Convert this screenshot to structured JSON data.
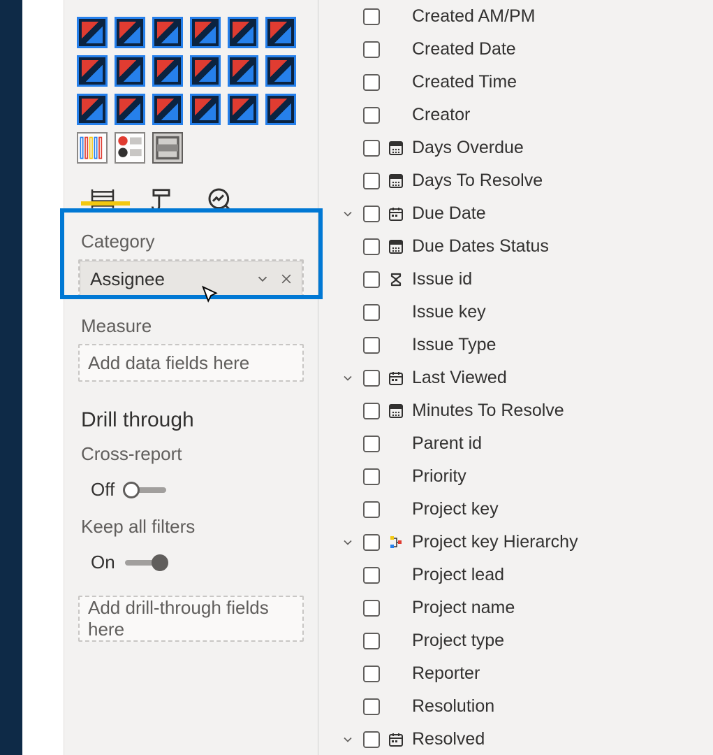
{
  "visualizations_panel": {
    "tabs": [
      "fields",
      "format",
      "analytics"
    ],
    "wells": {
      "category": {
        "label": "Category",
        "field": "Assignee"
      },
      "measure": {
        "label": "Measure",
        "placeholder": "Add data fields here"
      }
    },
    "drill_through": {
      "title": "Drill through",
      "cross_report": {
        "label": "Cross-report",
        "state_label": "Off",
        "on": false
      },
      "keep_filters": {
        "label": "Keep all filters",
        "state_label": "On",
        "on": true
      },
      "dropzone_placeholder": "Add drill-through fields here"
    }
  },
  "fields_panel": {
    "items": [
      {
        "name": "Created AM/PM",
        "type": null,
        "expandable": false
      },
      {
        "name": "Created Date",
        "type": null,
        "expandable": false
      },
      {
        "name": "Created Time",
        "type": null,
        "expandable": false
      },
      {
        "name": "Creator",
        "type": null,
        "expandable": false
      },
      {
        "name": "Days Overdue",
        "type": "calc",
        "expandable": false
      },
      {
        "name": "Days To Resolve",
        "type": "calc",
        "expandable": false
      },
      {
        "name": "Due Date",
        "type": "date",
        "expandable": true
      },
      {
        "name": "Due Dates Status",
        "type": "calc",
        "expandable": false
      },
      {
        "name": "Issue id",
        "type": "sigma",
        "expandable": false
      },
      {
        "name": "Issue key",
        "type": null,
        "expandable": false
      },
      {
        "name": "Issue Type",
        "type": null,
        "expandable": false
      },
      {
        "name": "Last Viewed",
        "type": "date",
        "expandable": true
      },
      {
        "name": "Minutes To Resolve",
        "type": "calc",
        "expandable": false
      },
      {
        "name": "Parent id",
        "type": null,
        "expandable": false
      },
      {
        "name": "Priority",
        "type": null,
        "expandable": false
      },
      {
        "name": "Project key",
        "type": null,
        "expandable": false
      },
      {
        "name": "Project key Hierarchy",
        "type": "hierarchy",
        "expandable": true
      },
      {
        "name": "Project lead",
        "type": null,
        "expandable": false
      },
      {
        "name": "Project name",
        "type": null,
        "expandable": false
      },
      {
        "name": "Project type",
        "type": null,
        "expandable": false
      },
      {
        "name": "Reporter",
        "type": null,
        "expandable": false
      },
      {
        "name": "Resolution",
        "type": null,
        "expandable": false
      },
      {
        "name": "Resolved",
        "type": "date",
        "expandable": true
      }
    ]
  }
}
